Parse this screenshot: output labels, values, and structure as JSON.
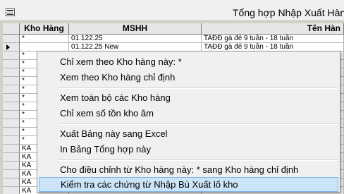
{
  "window": {
    "title": "Tổng hợp Nhập Xuất Hàng"
  },
  "table": {
    "columns": [
      "Kho Hàng",
      "MSHH",
      "Tên Hàn"
    ],
    "rows": [
      {
        "kho": "*",
        "mshh": "01.122.25",
        "ten": "TAĐĐ gà đẻ 9 tuần - 18 tuần"
      },
      {
        "kho": "",
        "mshh": "01.122.25 New",
        "ten": "TAĐĐ gà đẻ 9 tuần - 18 tuần"
      },
      {
        "kho": "*",
        "mshh": "",
        "ten": ""
      },
      {
        "kho": "*",
        "mshh": "",
        "ten": ""
      },
      {
        "kho": "*",
        "mshh": "",
        "ten": ""
      },
      {
        "kho": "*",
        "mshh": "",
        "ten": ""
      },
      {
        "kho": "*",
        "mshh": "",
        "ten": ""
      },
      {
        "kho": "*",
        "mshh": "",
        "ten": ""
      },
      {
        "kho": "*",
        "mshh": "",
        "ten": ""
      },
      {
        "kho": "*",
        "mshh": "",
        "ten": ""
      },
      {
        "kho": "*",
        "mshh": "",
        "ten": ""
      },
      {
        "kho": "*",
        "mshh": "",
        "ten": ""
      },
      {
        "kho": "*",
        "mshh": "",
        "ten": ""
      },
      {
        "kho": "KA",
        "mshh": "",
        "ten": ""
      },
      {
        "kho": "KA",
        "mshh": "",
        "ten": ""
      },
      {
        "kho": "KA",
        "mshh": "",
        "ten": ""
      },
      {
        "kho": "KA",
        "mshh": "",
        "ten": ""
      },
      {
        "kho": "KA",
        "mshh": "",
        "ten": ""
      },
      {
        "kho": "KA",
        "mshh": "",
        "ten": ""
      }
    ]
  },
  "context_menu": {
    "items": [
      "Chỉ xem theo Kho hàng này: *",
      "Xem theo Kho hàng chỉ định",
      "Xem toàn bộ các Kho hàng",
      "Chỉ xem số tồn kho âm",
      "Xuất Bảng này sang Excel",
      "In Bảng Tổng hợp này",
      "Cho điều chỉnh từ Kho hàng này: * sang Kho hàng chỉ định",
      "Kiểm tra các chứng từ Nhập Bù Xuất lố kho"
    ]
  },
  "colors": {
    "highlight_bg": "#cce4f7",
    "highlight_border": "#7eb4ea",
    "menu_bg": "#f0f0f0"
  }
}
